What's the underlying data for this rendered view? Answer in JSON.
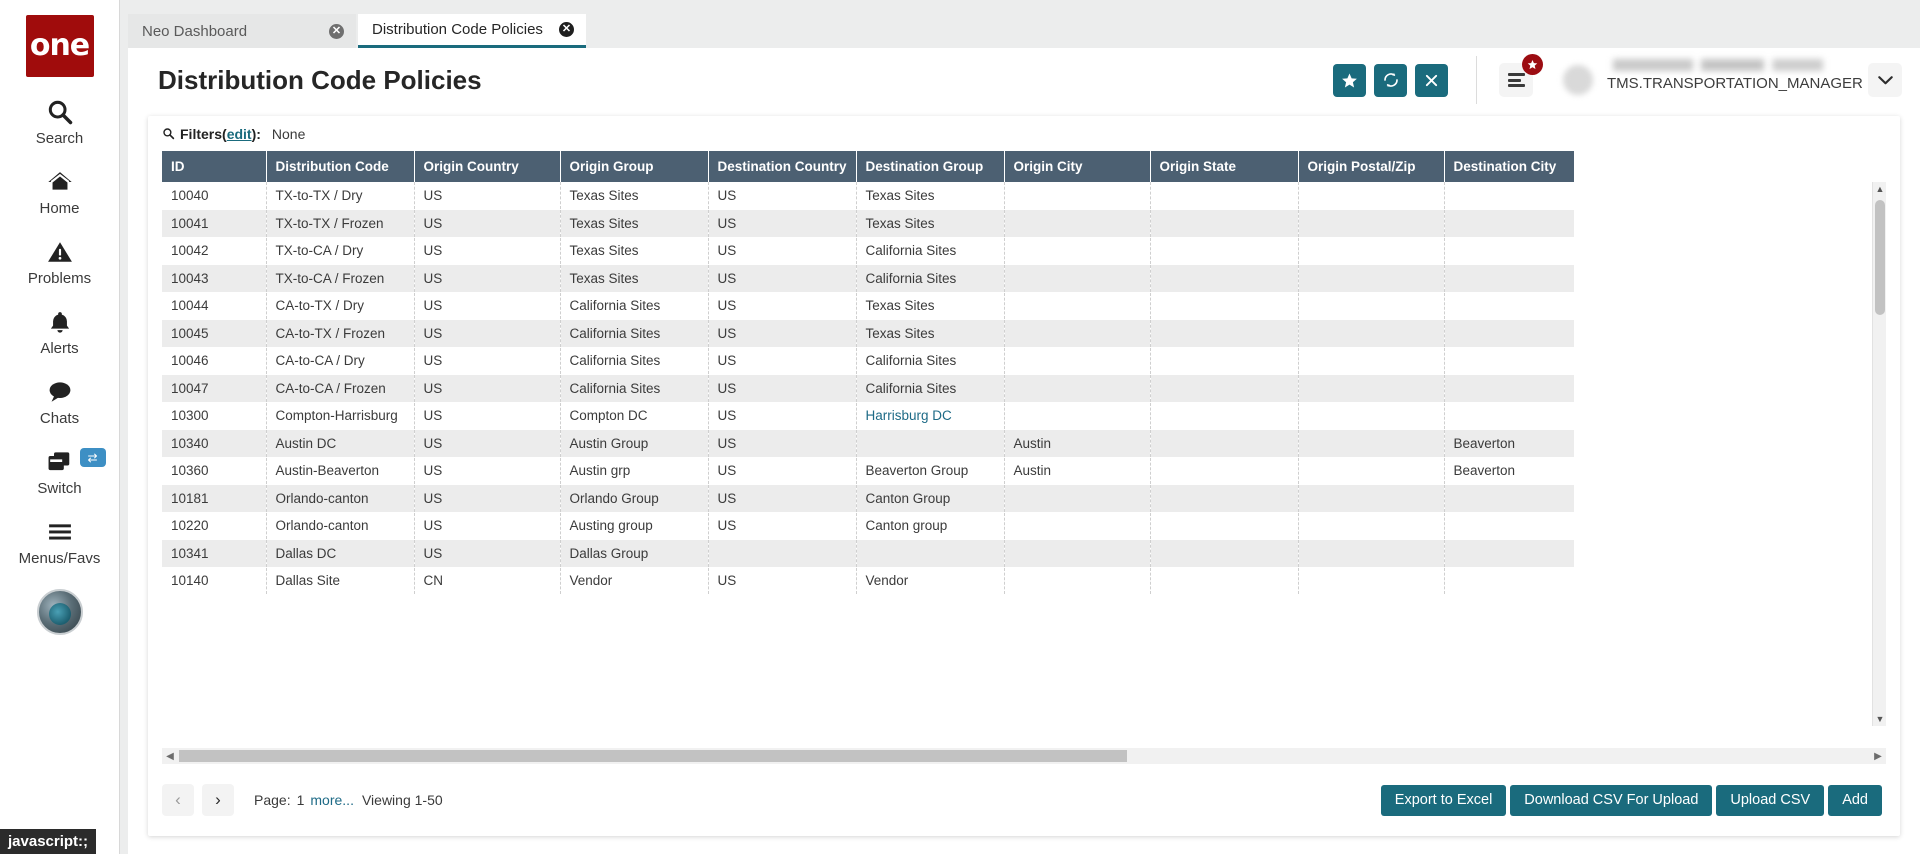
{
  "sidebar": {
    "logo_text": "one",
    "items": [
      {
        "label": "Search",
        "icon": "search-icon"
      },
      {
        "label": "Home",
        "icon": "home-icon"
      },
      {
        "label": "Problems",
        "icon": "warning-triangle-icon"
      },
      {
        "label": "Alerts",
        "icon": "bell-icon"
      },
      {
        "label": "Chats",
        "icon": "chat-bubble-icon"
      },
      {
        "label": "Switch",
        "icon": "windows-switch-icon",
        "badge": "⇄"
      },
      {
        "label": "Menus/Favs",
        "icon": "hamburger-icon"
      }
    ],
    "status_tooltip": "javascript:;"
  },
  "tabs": [
    {
      "label": "Neo Dashboard",
      "active": false,
      "close": "✕"
    },
    {
      "label": "Distribution Code Policies",
      "active": true,
      "close": "✕"
    }
  ],
  "header": {
    "title": "Distribution Code Policies",
    "actions": [
      {
        "name": "favorite-button",
        "glyph": "★"
      },
      {
        "name": "refresh-button",
        "glyph": "⟳"
      },
      {
        "name": "close-button",
        "glyph": "✕"
      }
    ],
    "menu_badge_glyph": "★",
    "user_role": "TMS.TRANSPORTATION_MANAGER",
    "caret_glyph": "⌄"
  },
  "filters": {
    "label": "Filters",
    "edit_link": "edit",
    "open_paren": "(",
    "close_paren": "):",
    "value": "None"
  },
  "table": {
    "columns": [
      "ID",
      "Distribution Code",
      "Origin Country",
      "Origin Group",
      "Destination Country",
      "Destination Group",
      "Origin City",
      "Origin State",
      "Origin Postal/Zip",
      "Destination City"
    ],
    "rows": [
      [
        "10040",
        "TX-to-TX / Dry",
        "US",
        "Texas Sites",
        "US",
        "Texas Sites",
        "",
        "",
        "",
        ""
      ],
      [
        "10041",
        "TX-to-TX / Frozen",
        "US",
        "Texas Sites",
        "US",
        "Texas Sites",
        "",
        "",
        "",
        ""
      ],
      [
        "10042",
        "TX-to-CA / Dry",
        "US",
        "Texas Sites",
        "US",
        "California Sites",
        "",
        "",
        "",
        ""
      ],
      [
        "10043",
        "TX-to-CA / Frozen",
        "US",
        "Texas Sites",
        "US",
        "California Sites",
        "",
        "",
        "",
        ""
      ],
      [
        "10044",
        "CA-to-TX / Dry",
        "US",
        "California Sites",
        "US",
        "Texas Sites",
        "",
        "",
        "",
        ""
      ],
      [
        "10045",
        "CA-to-TX / Frozen",
        "US",
        "California Sites",
        "US",
        "Texas Sites",
        "",
        "",
        "",
        ""
      ],
      [
        "10046",
        "CA-to-CA / Dry",
        "US",
        "California Sites",
        "US",
        "California Sites",
        "",
        "",
        "",
        ""
      ],
      [
        "10047",
        "CA-to-CA / Frozen",
        "US",
        "California Sites",
        "US",
        "California Sites",
        "",
        "",
        "",
        ""
      ],
      [
        "10300",
        "Compton-Harrisburg",
        "US",
        "Compton DC",
        "US",
        "Harrisburg DC",
        "",
        "",
        "",
        ""
      ],
      [
        "10340",
        "Austin DC",
        "US",
        "Austin Group",
        "US",
        "",
        "Austin",
        "",
        "",
        "Beaverton"
      ],
      [
        "10360",
        "Austin-Beaverton",
        "US",
        "Austin grp",
        "US",
        "Beaverton Group",
        "Austin",
        "",
        "",
        "Beaverton"
      ],
      [
        "10181",
        "Orlando-canton",
        "US",
        "Orlando Group",
        "US",
        "Canton Group",
        "",
        "",
        "",
        ""
      ],
      [
        "10220",
        "Orlando-canton",
        "US",
        "Austing group",
        "US",
        "Canton group",
        "",
        "",
        "",
        ""
      ],
      [
        "10341",
        "Dallas DC",
        "US",
        "Dallas Group",
        "",
        "",
        "",
        "",
        "",
        ""
      ],
      [
        "10140",
        "Dallas Site",
        "CN",
        "Vendor",
        "US",
        "Vendor",
        "",
        "",
        "",
        ""
      ]
    ],
    "link_cells": {
      "8": 5
    }
  },
  "footer": {
    "prev_glyph": "‹",
    "next_glyph": "›",
    "page_label": "Page:",
    "page_number": "1",
    "more_label": "more...",
    "viewing_label": "Viewing 1-50",
    "buttons": [
      "Export to Excel",
      "Download CSV For Upload",
      "Upload CSV",
      "Add"
    ]
  },
  "colors": {
    "brand_red": "#a00c0c",
    "accent_teal": "#1a6b7d",
    "header_slate": "#4c6072",
    "link_blue": "#1d6a86",
    "badge_blue": "#3d8fc4",
    "badge_red": "#9c0c12"
  }
}
